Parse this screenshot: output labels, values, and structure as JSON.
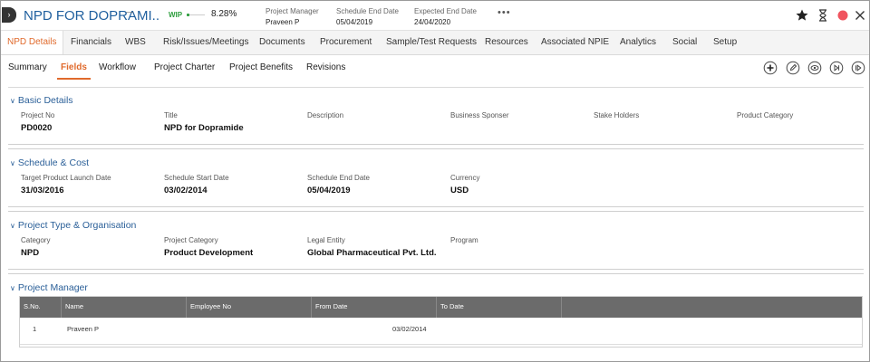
{
  "header": {
    "project_title": "NPD FOR DOPRAMI..",
    "title_mark": "—",
    "status": "WIP",
    "progress_fraction": 0.0828,
    "progress_text": "8.28%",
    "project_manager_label": "Project Manager",
    "project_manager_value": "Praveen P",
    "schedule_end_label": "Schedule End Date",
    "schedule_end_value": "05/04/2019",
    "expected_end_label": "Expected End Date",
    "expected_end_value": "24/04/2020",
    "more": "•••"
  },
  "tabs": [
    "NPD Details",
    "Financials",
    "WBS",
    "Risk/Issues/Meetings",
    "Documents",
    "Procurement",
    "Sample/Test Requests",
    "Resources",
    "Associated NPIE",
    "Analytics",
    "Social",
    "Setup"
  ],
  "subtabs": [
    "Summary",
    "Fields",
    "Workflow",
    "Project Charter",
    "Project Benefits",
    "Revisions"
  ],
  "sections": {
    "basic": {
      "title": "Basic Details",
      "fields": [
        {
          "label": "Project No",
          "value": "PD0020"
        },
        {
          "label": "Title",
          "value": "NPD for Dopramide"
        },
        {
          "label": "Description",
          "value": ""
        },
        {
          "label": "Business Sponser",
          "value": ""
        },
        {
          "label": "Stake Holders",
          "value": ""
        },
        {
          "label": "Product Category",
          "value": ""
        }
      ]
    },
    "schedule": {
      "title": "Schedule & Cost",
      "fields": [
        {
          "label": "Target Product Launch Date",
          "value": "31/03/2016"
        },
        {
          "label": "Schedule Start Date",
          "value": "03/02/2014"
        },
        {
          "label": "Schedule End Date",
          "value": "05/04/2019"
        },
        {
          "label": "Currency",
          "value": "USD"
        }
      ]
    },
    "type": {
      "title": "Project Type & Organisation",
      "fields": [
        {
          "label": "Category",
          "value": "NPD"
        },
        {
          "label": "Project Category",
          "value": "Product Development"
        },
        {
          "label": "Legal Entity",
          "value": "Global Pharmaceutical Pvt. Ltd."
        },
        {
          "label": "Program",
          "value": ""
        }
      ]
    },
    "manager": {
      "title": "Project Manager",
      "columns": [
        "S.No.",
        "Name",
        "Employee No",
        "From Date",
        "To Date"
      ],
      "rows": [
        {
          "sno": "1",
          "name": "Praveen P",
          "emp": "",
          "from": "03/02/2014",
          "to": ""
        }
      ]
    }
  },
  "colors": {
    "accent_orange": "#e06a2c",
    "title_blue": "#1f5f9e",
    "wip_green": "#2e9e3e",
    "table_header": "#6b6b6b"
  }
}
